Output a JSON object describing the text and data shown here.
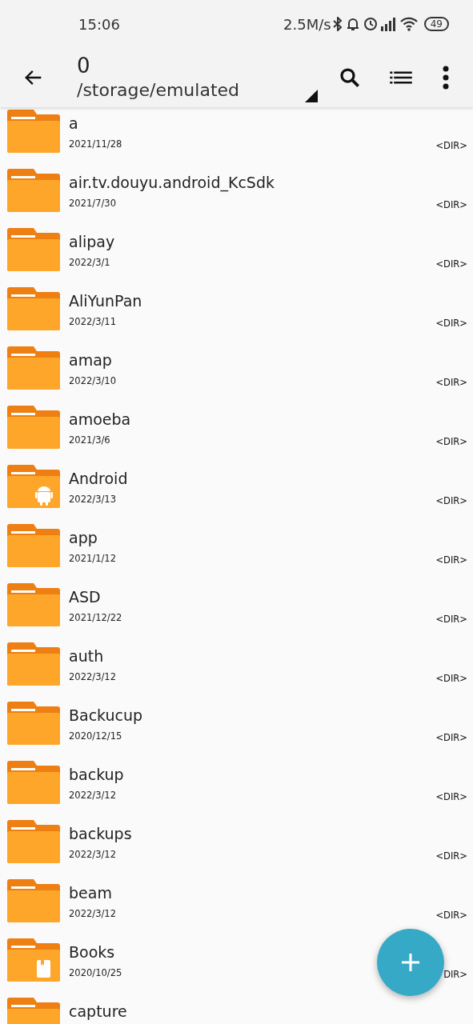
{
  "status_bar": {
    "time": "15:06",
    "speed": "2.5M/s",
    "battery": "49"
  },
  "toolbar": {
    "title": "0",
    "path": "/storage/emulated"
  },
  "files": [
    {
      "name": "a",
      "date": "2021/11/28",
      "type": "<DIR>",
      "kind": "plain"
    },
    {
      "name": "air.tv.douyu.android_KcSdk",
      "date": "2021/7/30",
      "type": "<DIR>",
      "kind": "plain"
    },
    {
      "name": "alipay",
      "date": "2022/3/1",
      "type": "<DIR>",
      "kind": "plain"
    },
    {
      "name": "AliYunPan",
      "date": "2022/3/11",
      "type": "<DIR>",
      "kind": "plain"
    },
    {
      "name": "amap",
      "date": "2022/3/10",
      "type": "<DIR>",
      "kind": "plain"
    },
    {
      "name": "amoeba",
      "date": "2021/3/6",
      "type": "<DIR>",
      "kind": "plain"
    },
    {
      "name": "Android",
      "date": "2022/3/13",
      "type": "<DIR>",
      "kind": "android"
    },
    {
      "name": "app",
      "date": "2021/1/12",
      "type": "<DIR>",
      "kind": "plain"
    },
    {
      "name": "ASD",
      "date": "2021/12/22",
      "type": "<DIR>",
      "kind": "plain"
    },
    {
      "name": "auth",
      "date": "2022/3/12",
      "type": "<DIR>",
      "kind": "plain"
    },
    {
      "name": "Backucup",
      "date": "2020/12/15",
      "type": "<DIR>",
      "kind": "plain"
    },
    {
      "name": "backup",
      "date": "2022/3/12",
      "type": "<DIR>",
      "kind": "plain"
    },
    {
      "name": "backups",
      "date": "2022/3/12",
      "type": "<DIR>",
      "kind": "plain"
    },
    {
      "name": "beam",
      "date": "2022/3/12",
      "type": "<DIR>",
      "kind": "plain"
    },
    {
      "name": "Books",
      "date": "2020/10/25",
      "type": "DIR>",
      "kind": "book"
    },
    {
      "name": "capture",
      "kind": "plain"
    }
  ]
}
